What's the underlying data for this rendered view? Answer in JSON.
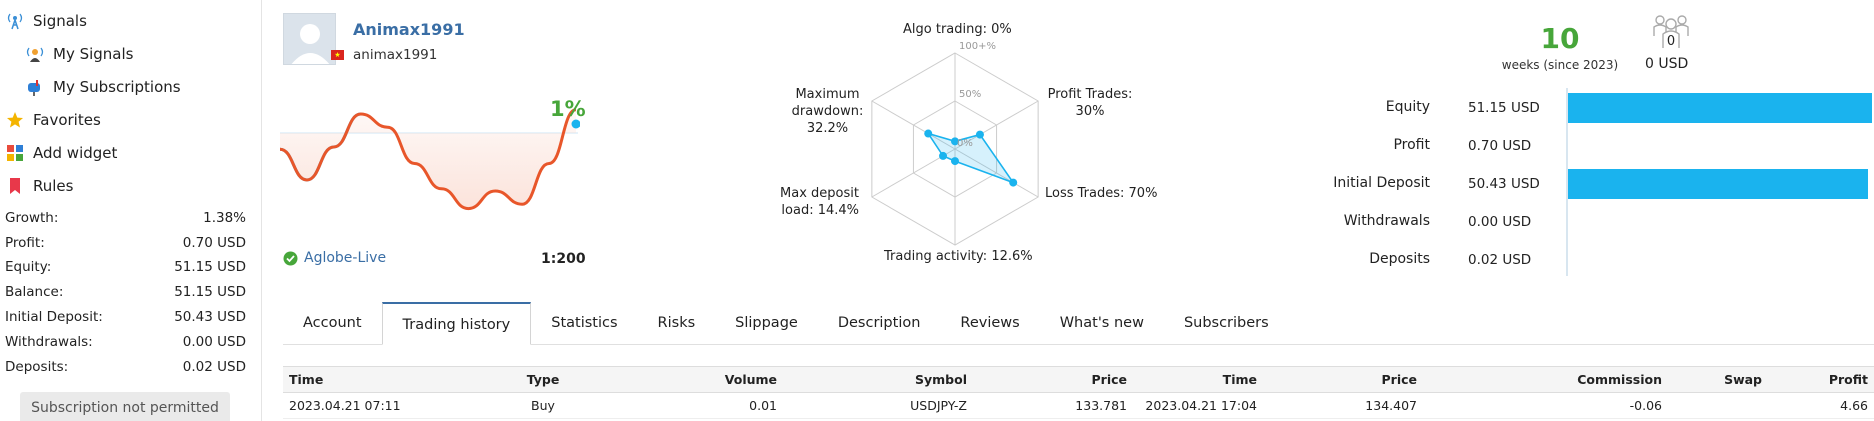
{
  "sidebar": {
    "signals": "Signals",
    "my_signals": "My Signals",
    "my_subscriptions": "My Subscriptions",
    "favorites": "Favorites",
    "add_widget": "Add widget",
    "rules": "Rules",
    "stats": [
      {
        "label": "Growth:",
        "value": "1.38%"
      },
      {
        "label": "Profit:",
        "value": "0.70 USD"
      },
      {
        "label": "Equity:",
        "value": "51.15 USD"
      },
      {
        "label": "Balance:",
        "value": "51.15 USD"
      },
      {
        "label": "Initial Deposit:",
        "value": "50.43 USD"
      },
      {
        "label": "Withdrawals:",
        "value": "0.00 USD"
      },
      {
        "label": "Deposits:",
        "value": "0.02 USD"
      }
    ],
    "subscribe_button": "Subscription not permitted"
  },
  "profile": {
    "name": "Animax1991",
    "login": "animax1991",
    "growth": "1%",
    "broker": "Aglobe-Live",
    "leverage": "1:200",
    "growth_curve": [
      0.42,
      0.7,
      0.4,
      0.1,
      0.22,
      0.55,
      0.78,
      0.96,
      0.8,
      0.92,
      0.55,
      0.06
    ]
  },
  "radar": {
    "algo": "Algo trading: 0%",
    "profit_trades": "Profit Trades:",
    "profit_trades_val": "30%",
    "loss_trades": "Loss Trades: 70%",
    "activity": "Trading activity: 12.6%",
    "deposit_load": "Max deposit",
    "deposit_load_val": "load: 14.4%",
    "drawdown_1": "Maximum",
    "drawdown_2": "drawdown:",
    "drawdown_3": "32.2%",
    "ring_100": "100+%",
    "ring_50": "50%",
    "ring_0": "0%",
    "values": {
      "algo": 0,
      "profit": 30,
      "loss": 70,
      "activity": 12.6,
      "deposit_load": 14.4,
      "drawdown": 32.2
    }
  },
  "summary": {
    "weeks": "10",
    "weeks_label": "weeks (since 2023)",
    "subscribers_count": "0",
    "subscribers_usd": "0 USD",
    "bars": [
      {
        "label": "Equity",
        "value": "51.15 USD",
        "fill": 1.0
      },
      {
        "label": "Profit",
        "value": "0.70 USD",
        "fill": 0.0
      },
      {
        "label": "Initial Deposit",
        "value": "50.43 USD",
        "fill": 0.986
      },
      {
        "label": "Withdrawals",
        "value": "0.00 USD",
        "fill": 0.0
      },
      {
        "label": "Deposits",
        "value": "0.02 USD",
        "fill": 0.0
      }
    ]
  },
  "tabs": [
    "Account",
    "Trading history",
    "Statistics",
    "Risks",
    "Slippage",
    "Description",
    "Reviews",
    "What's new",
    "Subscribers"
  ],
  "active_tab": 1,
  "table": {
    "headers": [
      "Time",
      "Type",
      "Volume",
      "Symbol",
      "Price",
      "Time",
      "Price",
      "Commission",
      "Swap",
      "Profit"
    ],
    "rows": [
      [
        "2023.04.21 07:11",
        "Buy",
        "0.01",
        "USDJPY-Z",
        "133.781",
        "2023.04.21 17:04",
        "134.407",
        "-0.06",
        "",
        "4.66"
      ]
    ]
  },
  "colors": {
    "accent": "#3a6ea5",
    "green": "#47a63a",
    "bar": "#1ab3ee",
    "loss_curve": "#e8562a",
    "gain_curve": "#3ea6e0"
  }
}
